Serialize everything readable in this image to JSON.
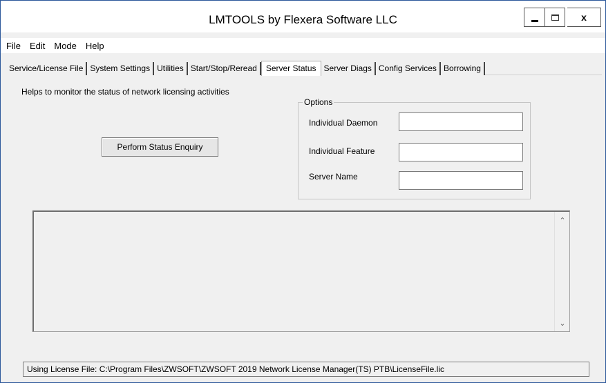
{
  "window": {
    "title": "LMTOOLS by Flexera Software LLC"
  },
  "menu": [
    "File",
    "Edit",
    "Mode",
    "Help"
  ],
  "tabs": [
    "Service/License File",
    "System Settings",
    "Utilities",
    "Start/Stop/Reread",
    "Server Status",
    "Server Diags",
    "Config Services",
    "Borrowing"
  ],
  "active_tab": "Server Status",
  "panel": {
    "helper_text": "Helps to monitor the status of network licensing activities",
    "status_button": "Perform Status Enquiry"
  },
  "options": {
    "legend": "Options",
    "daemon_label": "Individual Daemon",
    "daemon_value": "",
    "feature_label": "Individual Feature",
    "feature_value": "",
    "server_label": "Server Name",
    "server_value": ""
  },
  "output": {
    "text": ""
  },
  "status_bar": {
    "text": "Using License File:  C:\\Program Files\\ZWSOFT\\ZWSOFT 2019 Network License Manager(TS) PTB\\LicenseFile.lic"
  }
}
